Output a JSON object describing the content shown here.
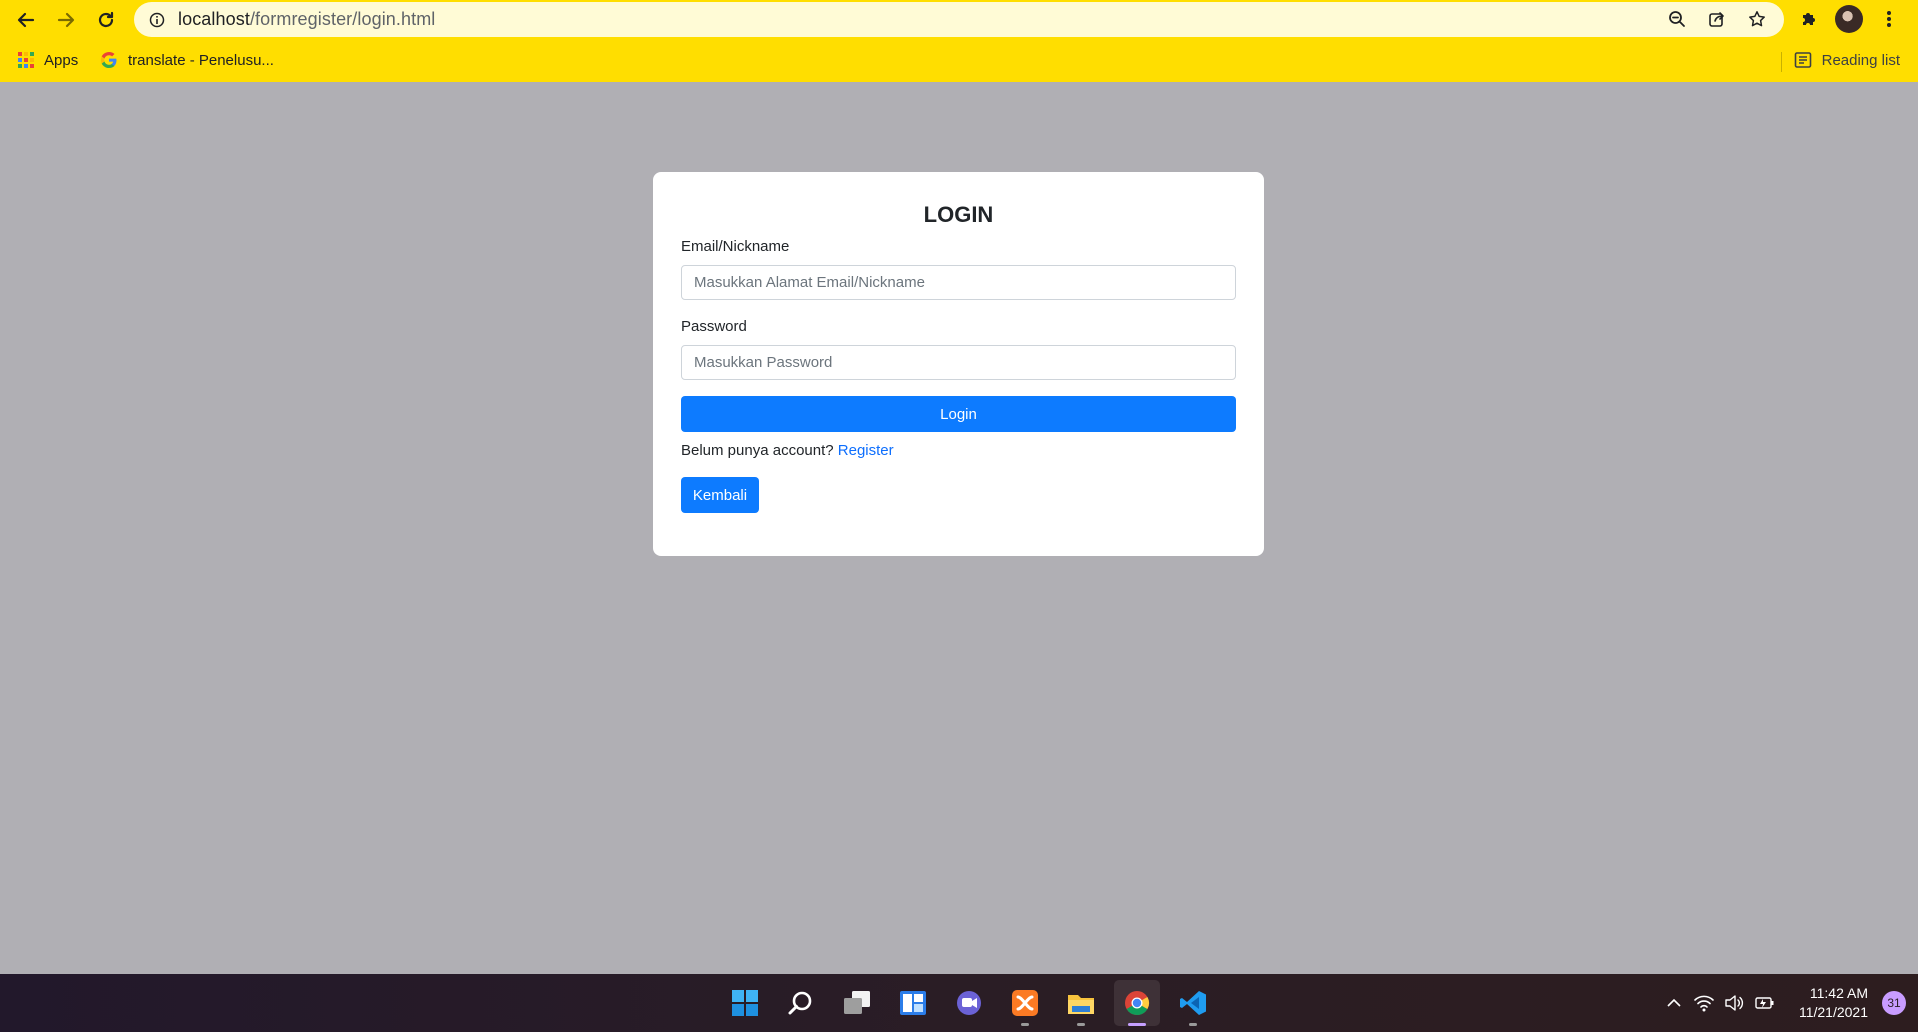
{
  "browser": {
    "url_host": "localhost",
    "url_path": "/formregister/login.html",
    "bookmarks": {
      "apps_label": "Apps",
      "translate_label": "translate - Penelusu...",
      "reading_list_label": "Reading list"
    },
    "icons": [
      "back-arrow-icon",
      "forward-arrow-icon",
      "reload-icon",
      "info-icon",
      "zoom-icon",
      "share-icon",
      "star-icon",
      "extensions-puzzle-icon",
      "profile-avatar",
      "more-vert-icon"
    ],
    "chrome_color": "#ffde00"
  },
  "login": {
    "title": "LOGIN",
    "email_label": "Email/Nickname",
    "email_placeholder": "Masukkan Alamat Email/Nickname",
    "email_value": "",
    "password_label": "Password",
    "password_placeholder": "Masukkan Password",
    "password_value": "",
    "login_button": "Login",
    "register_prompt": "Belum punya account?",
    "register_link": "Register",
    "back_button": "Kembali",
    "accent_color": "#0d7bff"
  },
  "taskbar": {
    "apps": [
      "windows-start",
      "search",
      "task-view",
      "widgets",
      "teams-chat",
      "xampp",
      "file-explorer",
      "chrome",
      "vs-code"
    ],
    "time": "11:42 AM",
    "date": "11/21/2021",
    "notification_count": "31"
  }
}
